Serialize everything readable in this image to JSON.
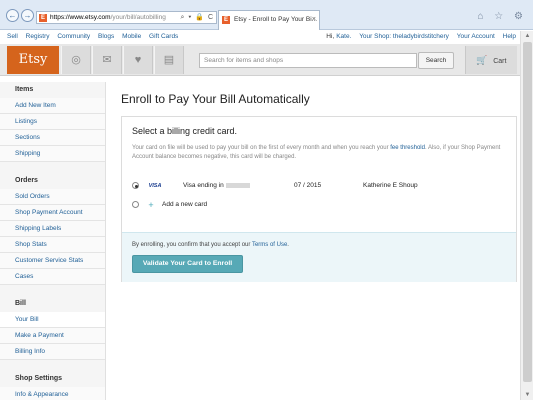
{
  "browser": {
    "url_domain": "https://www.etsy.com",
    "url_path": "/your/bill/autobilling",
    "url_controls": "⌕ ▾ 🔒 C",
    "tab_title": "Etsy - Enroll to Pay Your Bi...",
    "tab_close": "×",
    "back": "←",
    "forward": "→",
    "favicon_letter": "E",
    "chrome_icons": "⌂ ☆ ⚙"
  },
  "toplinks": {
    "left": [
      "Sell",
      "Registry",
      "Community",
      "Blogs",
      "Mobile",
      "Gift Cards"
    ],
    "greeting": "Hi,",
    "user": "Kate.",
    "shop": "Your Shop: theladybirdstitchery",
    "account": "Your Account",
    "help": "Help"
  },
  "header": {
    "logo": "Etsy",
    "icons": [
      "◎",
      "✉",
      "♥",
      "▤"
    ],
    "search_placeholder": "Search for items and shops",
    "search_button": "Search",
    "cart_icon": "🛒",
    "cart_label": "Cart"
  },
  "sidebar": {
    "sections": [
      {
        "title": "Items",
        "items": [
          "Add New Item",
          "Listings",
          "Sections",
          "Shipping"
        ]
      },
      {
        "title": "Orders",
        "items": [
          "Sold Orders",
          "Shop Payment Account",
          "Shipping Labels",
          "Shop Stats",
          "Customer Service Stats",
          "Cases"
        ]
      },
      {
        "title": "Bill",
        "items": [
          "Your Bill",
          "Make a Payment",
          "Billing Info"
        ]
      },
      {
        "title": "Shop Settings",
        "items": [
          "Info & Appearance"
        ]
      }
    ],
    "active_item": "Your Bill"
  },
  "main": {
    "title": "Enroll to Pay Your Bill Automatically",
    "card_heading": "Select a billing credit card.",
    "desc_part1": "Your card on file will be used to pay your bill on the first of every month and when you reach your ",
    "desc_link": "fee threshold",
    "desc_part2": ". Also, if your Shop Payment Account balance becomes negative, this card will be charged.",
    "card_row": {
      "brand": "VISA",
      "ending_label": "Visa ending in",
      "expiry": "07 / 2015",
      "holder": "Katherine E Shoup",
      "selected": true
    },
    "add_card": {
      "icon": "+",
      "label": "Add a new card"
    },
    "consent_text": "By enrolling, you confirm that you accept our ",
    "consent_link": "Terms of Use",
    "consent_end": ".",
    "validate_button": "Validate Your Card to Enroll"
  },
  "scrollbar": {
    "up": "▲",
    "down": "▼"
  }
}
